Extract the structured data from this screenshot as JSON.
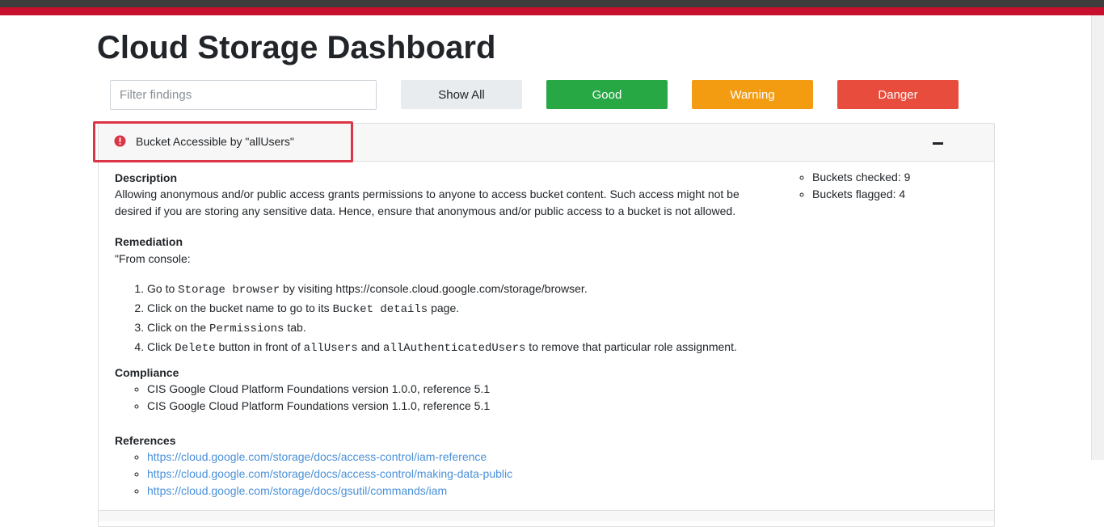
{
  "title": "Cloud Storage Dashboard",
  "filter": {
    "placeholder": "Filter findings"
  },
  "filters": {
    "show_all": "Show All",
    "good": "Good",
    "warning": "Warning",
    "danger": "Danger"
  },
  "colors": {
    "header_dark": "#3d3d3d",
    "header_red": "#c8102e",
    "good": "#28a745",
    "warning": "#f39c12",
    "danger": "#e74c3c",
    "link": "#4a90d9"
  },
  "finding": {
    "icon": "alert-circle-icon",
    "title": "Bucket Accessible by \"allUsers\"",
    "collapse_icon": "minus-icon",
    "description_heading": "Description",
    "description": "Allowing anonymous and/or public access grants permissions to anyone to access bucket content. Such access might not be desired if you are storing any sensitive data. Hence, ensure that anonymous and/or public access to a bucket is not allowed.",
    "remediation_heading": "Remediation",
    "remediation_intro": "\"From console:",
    "steps": [
      {
        "a": "Go to ",
        "code1": "Storage browser",
        "b": " by visiting https://console.cloud.google.com/storage/browser."
      },
      {
        "a": "Click on the bucket name to go to its ",
        "code1": "Bucket details",
        "b": " page."
      },
      {
        "a": "Click on the ",
        "code1": "Permissions",
        "b": " tab."
      },
      {
        "a": "Click ",
        "code1": "Delete",
        "b": " button in front of ",
        "code2": "allUsers",
        "c": " and ",
        "code3": "allAuthenticatedUsers",
        "d": " to remove that particular role assignment."
      }
    ],
    "compliance_heading": "Compliance",
    "compliance": [
      "CIS Google Cloud Platform Foundations version 1.0.0, reference 5.1",
      "CIS Google Cloud Platform Foundations version 1.1.0, reference 5.1"
    ],
    "references_heading": "References",
    "references": [
      "https://cloud.google.com/storage/docs/access-control/iam-reference",
      "https://cloud.google.com/storage/docs/access-control/making-data-public",
      "https://cloud.google.com/storage/docs/gsutil/commands/iam"
    ],
    "stats": [
      "Buckets checked: 9",
      "Buckets flagged: 4"
    ]
  }
}
